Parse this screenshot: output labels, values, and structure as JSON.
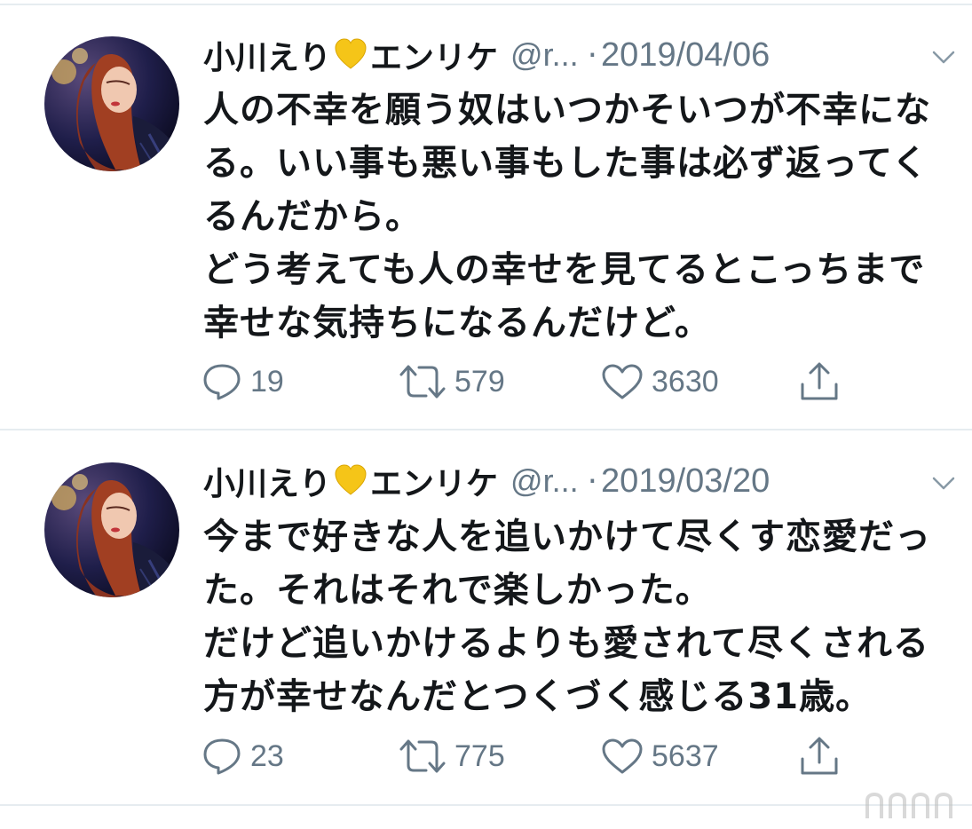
{
  "tweets": [
    {
      "display_name": "小川えり",
      "display_name_suffix": "エンリケ",
      "name_emoji": "yellow-heart",
      "handle": "@r...",
      "separator": "·",
      "date": "2019/04/06",
      "text": "人の不幸を願う奴はいつかそいつが不幸にな\nる。いい事も悪い事もした事は必ず返ってく\nるんだから。\nどう考えても人の幸せを見てるとこっちまで\n幸せな気持ちになるんだけど。",
      "replies": "19",
      "retweets": "579",
      "likes": "3630"
    },
    {
      "display_name": "小川えり",
      "display_name_suffix": "エンリケ",
      "name_emoji": "yellow-heart",
      "handle": "@r...",
      "separator": "·",
      "date": "2019/03/20",
      "text": "今まで好きな人を追いかけて尽くす恋愛だっ\nた。それはそれで楽しかった。\nだけど追いかけるよりも愛されて尽くされる\n方が幸せなんだとつくづく感じる31歳。",
      "replies": "23",
      "retweets": "775",
      "likes": "5637"
    }
  ],
  "colors": {
    "text": "#14171a",
    "secondary": "#657786",
    "divider": "#e6ecf0",
    "emoji_heart": "#f5c518"
  },
  "icons": {
    "reply": "reply-icon",
    "retweet": "retweet-icon",
    "like": "heart-outline-icon",
    "share": "share-icon",
    "menu": "chevron-down-icon"
  }
}
